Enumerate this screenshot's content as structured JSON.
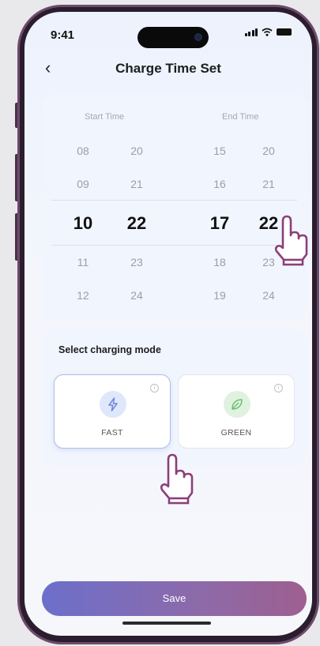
{
  "status_bar": {
    "time": "9:41"
  },
  "header": {
    "title": "Charge Time Set"
  },
  "picker": {
    "start_label": "Start Time",
    "end_label": "End Time",
    "start_hours": [
      "08",
      "09",
      "10",
      "11",
      "12"
    ],
    "start_minutes": [
      "20",
      "21",
      "22",
      "23",
      "24"
    ],
    "end_hours": [
      "15",
      "16",
      "17",
      "18",
      "19"
    ],
    "end_minutes": [
      "20",
      "21",
      "22",
      "23",
      "24"
    ]
  },
  "mode": {
    "label": "Select charging mode",
    "options": [
      {
        "label": "FAST",
        "icon": "lightning-icon",
        "selected": true,
        "color": "#6d86d9"
      },
      {
        "label": "GREEN",
        "icon": "leaf-icon",
        "selected": false,
        "color": "#6cbf6e"
      }
    ]
  },
  "save_label": "Save",
  "colors": {
    "accent_start": "#6c6fcb",
    "accent_end": "#9e5f8f",
    "hand": "#8b3f7a"
  }
}
